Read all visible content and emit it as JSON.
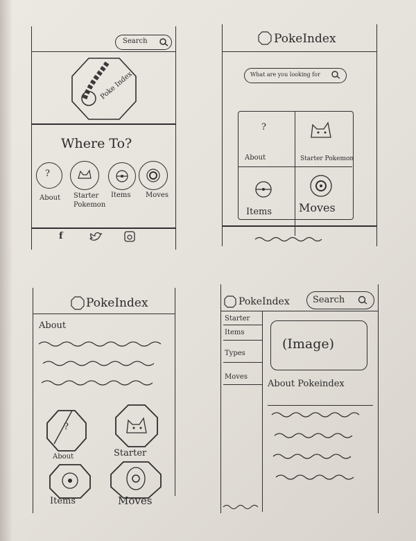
{
  "wireframe1": {
    "search_label": "Search",
    "logo_text": "Poke Index",
    "heading": "Where To?",
    "nav": [
      {
        "label": "About",
        "icon": "question-icon"
      },
      {
        "label": "Starter Pokemon",
        "icon": "pokemon-icon"
      },
      {
        "label": "Items",
        "icon": "pokeball-icon"
      },
      {
        "label": "Moves",
        "icon": "pokeball-icon"
      }
    ],
    "footer_icons": [
      "facebook-icon",
      "twitter-icon",
      "instagram-icon"
    ]
  },
  "wireframe2": {
    "title": "PokeIndex",
    "search_placeholder": "What are you looking for",
    "tiles": [
      {
        "label": "About",
        "icon": "question-icon"
      },
      {
        "label": "Starter Pokemon",
        "icon": "pokemon-icon"
      },
      {
        "label": "Items",
        "icon": "pokeball-icon"
      },
      {
        "label": "Moves",
        "icon": "pokeball-icon"
      }
    ]
  },
  "wireframe3": {
    "title": "PokeIndex",
    "about_label": "About",
    "tiles": [
      {
        "label": "About",
        "icon": "question-icon"
      },
      {
        "label": "Starter",
        "icon": "pokemon-icon"
      },
      {
        "label": "Items",
        "icon": "pokeball-icon"
      },
      {
        "label": "Moves",
        "icon": "pokeball-icon"
      }
    ]
  },
  "wireframe4": {
    "title": "PokeIndex",
    "search_label": "Search",
    "sidebar": [
      "Starter",
      "Items",
      "Types",
      "Moves"
    ],
    "image_placeholder": "(Image)",
    "about_heading": "About Pokeindex"
  }
}
